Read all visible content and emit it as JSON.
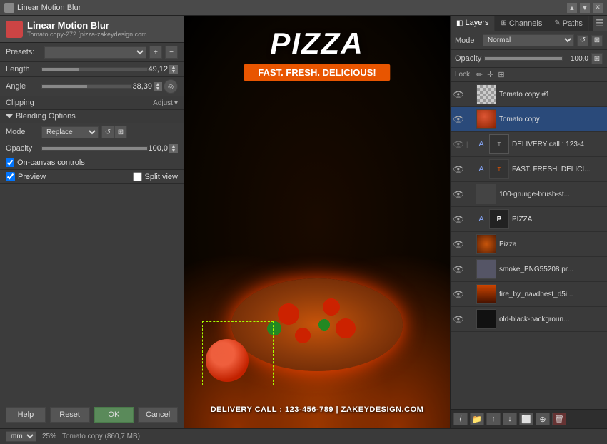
{
  "titleBar": {
    "title": "Linear Motion Blur",
    "icons": [
      "▲",
      "▼",
      "✕"
    ]
  },
  "dialog": {
    "title": "Linear Motion Blur",
    "subtitle": "Tomato copy-272 [pizza-zakeydesign.com...",
    "presets": {
      "label": "Presets:",
      "placeholder": ""
    },
    "length": {
      "label": "Length",
      "value": "49,12",
      "fillPercent": 35
    },
    "angle": {
      "label": "Angle",
      "value": "38,39",
      "fillPercent": 50
    },
    "clipping": {
      "label": "Clipping",
      "adjustLabel": "Adjust"
    },
    "blendingOptions": {
      "label": "Blending Options"
    },
    "mode": {
      "label": "Mode",
      "value": "Replace"
    },
    "opacity": {
      "label": "Opacity",
      "value": "100,0"
    },
    "onCanvasControls": {
      "label": "On-canvas controls"
    },
    "preview": {
      "label": "Preview",
      "splitView": "Split view"
    },
    "buttons": {
      "help": "Help",
      "reset": "Reset",
      "ok": "OK",
      "cancel": "Cancel"
    }
  },
  "canvas": {
    "pizzaTitle": "PIZZA",
    "pizzaSubtitle": "FAST. FRESH. DELICIOUS!",
    "deliveryText": "DELIVERY CALL : 123-456-789 | ZAKEYDESIGN.COM"
  },
  "layers": {
    "tabs": [
      {
        "label": "Layers",
        "icon": "◧",
        "active": true
      },
      {
        "label": "Channels",
        "icon": "⊞",
        "active": false
      },
      {
        "label": "Paths",
        "icon": "✎",
        "active": false
      }
    ],
    "mode": {
      "label": "Mode",
      "value": "Normal"
    },
    "opacity": {
      "label": "Opacity",
      "value": "100,0",
      "fillPercent": 100
    },
    "lock": {
      "label": "Lock:"
    },
    "items": [
      {
        "name": "Tomato copy #1",
        "type": "thumb",
        "eye": true,
        "active": false,
        "thumbBg": "#8b4513"
      },
      {
        "name": "Tomato copy",
        "type": "thumb",
        "eye": true,
        "active": true,
        "thumbBg": "#8b4513"
      },
      {
        "name": "DELIVERY call : 123-4",
        "type": "text",
        "eye": true,
        "active": false,
        "thumbBg": "#333"
      },
      {
        "name": "FAST. FRESH. DELICI...",
        "type": "text",
        "eye": true,
        "active": false,
        "thumbBg": "#333"
      },
      {
        "name": "100-grunge-brush-st...",
        "type": "thumb",
        "eye": true,
        "active": false,
        "thumbBg": "#555"
      },
      {
        "name": "PIZZA",
        "type": "text",
        "eye": true,
        "active": false,
        "thumbBg": "#333"
      },
      {
        "name": "Pizza",
        "type": "thumb",
        "eye": true,
        "active": false,
        "thumbBg": "#884400"
      },
      {
        "name": "smoke_PNG55208.pr...",
        "type": "thumb",
        "eye": true,
        "active": false,
        "thumbBg": "#666"
      },
      {
        "name": "fire_by_navdbest_d5i...",
        "type": "thumb",
        "eye": true,
        "active": false,
        "thumbBg": "#663300"
      },
      {
        "name": "old-black-backgroun...",
        "type": "thumb",
        "eye": true,
        "active": false,
        "thumbBg": "#222"
      }
    ],
    "bottomBar": {
      "buttons": [
        "⟨",
        "📁",
        "↑",
        "↓",
        "⬜",
        "⊕",
        "🗑"
      ]
    }
  },
  "bottomBar": {
    "unit": "mm",
    "zoom": "25%",
    "info": "Tomato copy (860,7 MB)"
  }
}
